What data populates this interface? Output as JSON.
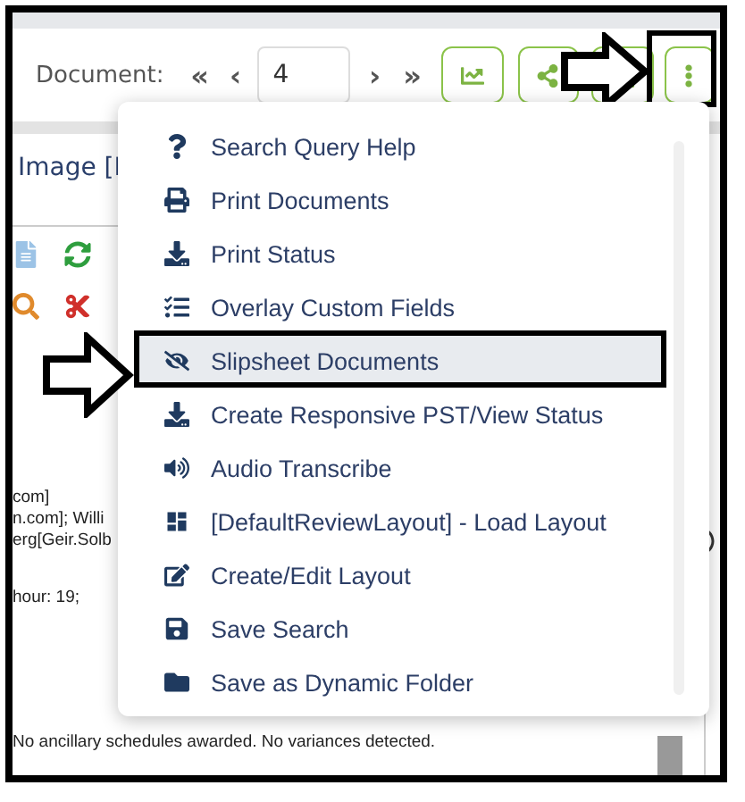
{
  "toolbar": {
    "label": "Document:",
    "first": "«",
    "prev": "‹",
    "page": "4",
    "next": "›",
    "last": "»"
  },
  "document": {
    "heading": "Image [I",
    "lines": [
      "com]",
      "n.com]; Willi",
      "erg[Geir.Solb",
      "hour: 19;",
      "No ancillary schedules awarded.  No variances detected."
    ]
  },
  "menu": [
    {
      "label": "Search Query Help",
      "selected": false
    },
    {
      "label": "Print Documents",
      "selected": false
    },
    {
      "label": "Print Status",
      "selected": false
    },
    {
      "label": "Overlay Custom Fields",
      "selected": false
    },
    {
      "label": "Slipsheet Documents",
      "selected": true
    },
    {
      "label": "Create Responsive PST/View Status",
      "selected": false
    },
    {
      "label": "Audio Transcribe",
      "selected": false
    },
    {
      "label": "[DefaultReviewLayout] - Load Layout",
      "selected": false
    },
    {
      "label": "Create/Edit Layout",
      "selected": false
    },
    {
      "label": "Save Search",
      "selected": false
    },
    {
      "label": "Save as Dynamic Folder",
      "selected": false
    }
  ]
}
